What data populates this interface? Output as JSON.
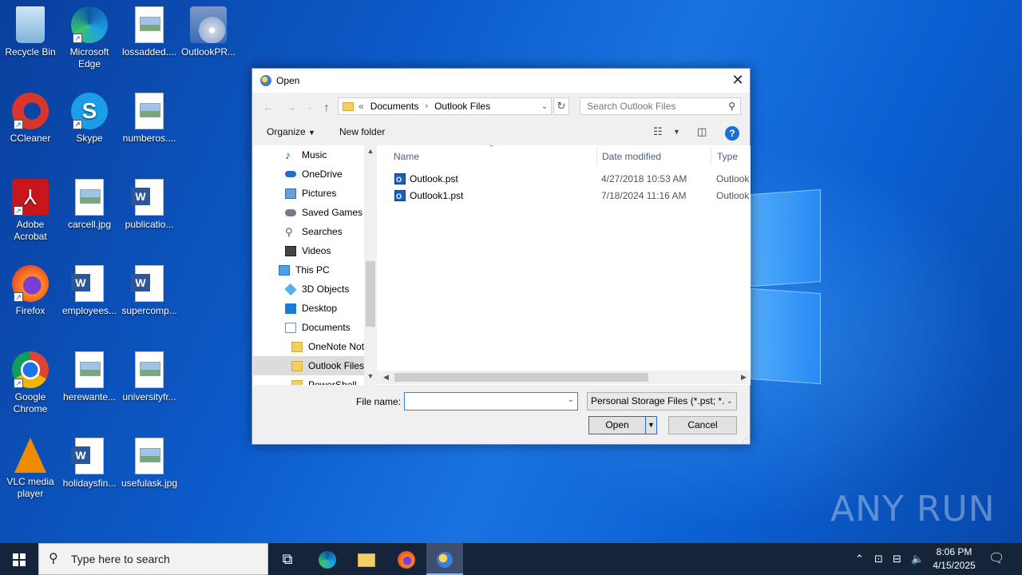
{
  "desktop": {
    "icons": [
      {
        "label": "Recycle Bin"
      },
      {
        "label": "Microsoft Edge"
      },
      {
        "label": "lossadded...."
      },
      {
        "label": "OutlookPR..."
      },
      {
        "label": "CCleaner"
      },
      {
        "label": "Skype"
      },
      {
        "label": "numberos...."
      },
      {
        "label": "Adobe Acrobat"
      },
      {
        "label": "carcell.jpg"
      },
      {
        "label": "publicatio..."
      },
      {
        "label": "Firefox"
      },
      {
        "label": "employees..."
      },
      {
        "label": "supercomp..."
      },
      {
        "label": "Google Chrome"
      },
      {
        "label": "herewante..."
      },
      {
        "label": "universityfr..."
      },
      {
        "label": "VLC media player"
      },
      {
        "label": "holidaysfin..."
      },
      {
        "label": "usefulask.jpg"
      }
    ],
    "watermark": "ANY RUN"
  },
  "dialog": {
    "title": "Open",
    "address": {
      "prefix": "«",
      "parts": [
        "Documents",
        "Outlook Files"
      ]
    },
    "search_placeholder": "Search Outlook Files",
    "toolbar": {
      "organize": "Organize",
      "new_folder": "New folder"
    },
    "nav": [
      {
        "label": "Music"
      },
      {
        "label": "OneDrive"
      },
      {
        "label": "Pictures"
      },
      {
        "label": "Saved Games"
      },
      {
        "label": "Searches"
      },
      {
        "label": "Videos"
      },
      {
        "label": "This PC"
      },
      {
        "label": "3D Objects"
      },
      {
        "label": "Desktop"
      },
      {
        "label": "Documents"
      },
      {
        "label": "OneNote Not"
      },
      {
        "label": "Outlook Files"
      },
      {
        "label": "PowerShell"
      }
    ],
    "columns": {
      "name": "Name",
      "date": "Date modified",
      "type": "Type"
    },
    "files": [
      {
        "name": "Outlook.pst",
        "date": "4/27/2018 10:53 AM",
        "type": "Outlook"
      },
      {
        "name": "Outlook1.pst",
        "date": "7/18/2024 11:16 AM",
        "type": "Outlook"
      }
    ],
    "file_name_label": "File name:",
    "file_name_value": "",
    "file_type": "Personal Storage Files (*.pst; *.c",
    "open_label": "Open",
    "cancel_label": "Cancel"
  },
  "taskbar": {
    "search_placeholder": "Type here to search",
    "time": "8:06 PM",
    "date": "4/15/2025"
  }
}
